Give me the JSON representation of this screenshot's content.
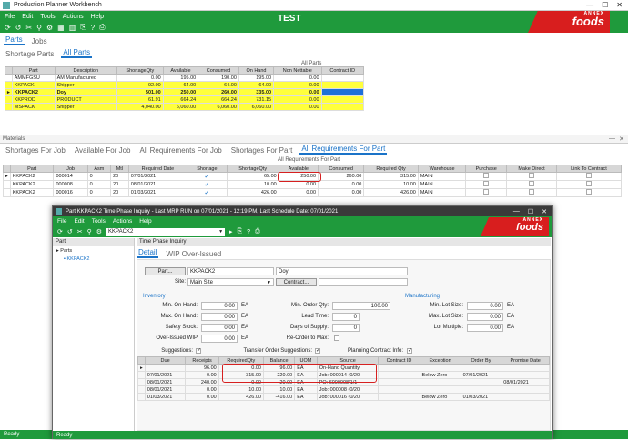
{
  "main": {
    "window_title": "Production Planner Workbench",
    "menu": [
      "File",
      "Edit",
      "Tools",
      "Actions",
      "Help"
    ],
    "title": "TEST",
    "logo_top": "ANNEX",
    "logo_bottom": "foods",
    "top_tabs": [
      "Parts",
      "Jobs"
    ],
    "sub_tabs": [
      "Shortage Parts",
      "All Parts"
    ],
    "grid_caption": "All Parts",
    "parts_columns": [
      "Part",
      "Description",
      "ShortageQty",
      "Available",
      "Consumed",
      "On Hand",
      "Non Nettable",
      "Contract ID"
    ],
    "parts_rows": [
      [
        "AMMFGSU",
        "AM Manufactured",
        "0.00",
        "195.00",
        "190.00",
        "195.00",
        "0.00",
        ""
      ],
      [
        "KKPACK",
        "Shipper",
        "92.00",
        "64.00",
        "64.00",
        "64.00",
        "0.00",
        ""
      ],
      [
        "KKPACK2",
        "Doy",
        "501.00",
        "250.00",
        "260.00",
        "335.00",
        "0.00",
        ""
      ],
      [
        "KKPROD",
        "PRODUCT",
        "61.91",
        "664.24",
        "664.24",
        "731.15",
        "0.00",
        ""
      ],
      [
        "MSPACK",
        "Shipper",
        "4,040.00",
        "6,060.00",
        "6,060.00",
        "6,060.00",
        "0.00",
        ""
      ]
    ],
    "materials_label": "Materials",
    "mat_tabs": [
      "Shortages For Job",
      "Available For Job",
      "All Requirements For Job",
      "Shortages For Part",
      "All Requirements For Part"
    ],
    "mat_caption": "All Requirements For Part",
    "mat_columns": [
      "Part",
      "Job",
      "Asm",
      "Mtl",
      "Required Date",
      "Shortage",
      "ShortageQty",
      "Available",
      "Consumed",
      "Required Qty",
      "Warehouse",
      "Purchase",
      "Make Direct",
      "Link To Contract"
    ],
    "mat_rows": [
      [
        "KKPACK2",
        "000014",
        "0",
        "20",
        "07/01/2021",
        "✓",
        "65.00",
        "250.00",
        "260.00",
        "315.00",
        "MAIN"
      ],
      [
        "KKPACK2",
        "000008",
        "0",
        "20",
        "08/01/2021",
        "✓",
        "10.00",
        "0.00",
        "0.00",
        "10.00",
        "MAIN"
      ],
      [
        "KKPACK2",
        "000016",
        "0",
        "20",
        "01/03/2021",
        "✓",
        "426.00",
        "0.00",
        "0.00",
        "426.00",
        "MAIN"
      ]
    ],
    "status": "Ready"
  },
  "tp": {
    "window_title": "Part KKPACK2 Time Phase Inquiry  - Last MRP RUN on 07/01/2021 - 12:19 PM, Last Schedule Date: 07/01/2021",
    "menu": [
      "File",
      "Edit",
      "Tools",
      "Actions",
      "Help"
    ],
    "part_combo": "KKPACK2",
    "tree_header": "Part",
    "tree_root": "Parts",
    "tree_child": "KKPACK2",
    "panel_title": "Time Phase Inquiry",
    "tabs": [
      "Detail",
      "WIP Over-Issued"
    ],
    "part_btn": "Part...",
    "part_value": "KKPACK2",
    "part_desc": "Doy",
    "site_label": "Site:",
    "site_value": "Main Site",
    "contract_btn": "Contract...",
    "inventory_label": "Inventory",
    "manufacturing_label": "Manufacturing",
    "left_labels": [
      "Min. On Hand:",
      "Max. On Hand:",
      "Safety Stock:",
      "Over-Issued WIP"
    ],
    "left_values": [
      "0.00",
      "0.00",
      "0.00",
      "0.00"
    ],
    "unit": "EA",
    "mid_labels": [
      "Min. Order Qty:",
      "Lead Time:",
      "Days of Supply:",
      "Re-Order to Max:"
    ],
    "mid_values": [
      "100.00",
      "0",
      "0"
    ],
    "right_labels": [
      "Min. Lot Size:",
      "Max. Lot Size:",
      "Lot Multiple:"
    ],
    "right_values": [
      "0.00",
      "0.00",
      "0.00"
    ],
    "check_labels": [
      "Suggestions:",
      "Transfer Order Suggestions:",
      "Planning Contract Info:"
    ],
    "grid_columns": [
      "Due",
      "Receipts",
      "RequiredQty",
      "Balance",
      "UOM",
      "Source",
      "Contract ID",
      "Exception",
      "Order By",
      "Promise Date"
    ],
    "grid_rows": [
      [
        "",
        "96.00",
        "0.00",
        "96.00",
        "EA",
        "On-Hand Quantity",
        "",
        "",
        "",
        ""
      ],
      [
        "07/01/2021",
        "0.00",
        "315.00",
        "-220.00",
        "EA",
        "Job: 000014 (0/20",
        "",
        "Below Zero",
        "07/01/2021",
        ""
      ],
      [
        "08/01/2021",
        "240.00",
        "0.00",
        "20.00",
        "EA",
        "PO: 6000008/1/1",
        "",
        "",
        "",
        "08/01/2021"
      ],
      [
        "08/01/2021",
        "0.00",
        "10.00",
        "10.00",
        "EA",
        "Job: 000008 (0/20",
        "",
        "",
        "",
        ""
      ],
      [
        "01/03/2021",
        "0.00",
        "426.00",
        "-416.00",
        "EA",
        "Job: 000016 (0/20",
        "",
        "Below Zero",
        "01/03/2021",
        ""
      ]
    ],
    "status": "Ready"
  },
  "colors": {
    "brand_green": "#1f9a3c",
    "highlight_yellow": "#ffff3c",
    "annotation_red": "#d62020",
    "logo_red": "#d81e1e",
    "accent_blue": "#1a73c8"
  }
}
